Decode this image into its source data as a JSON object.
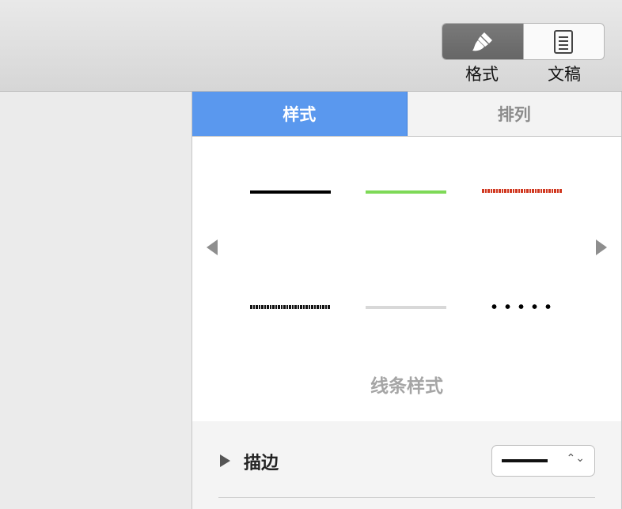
{
  "toolbar": {
    "format_label": "格式",
    "document_label": "文稿"
  },
  "inspector": {
    "tabs": [
      {
        "label": "样式",
        "active": true
      },
      {
        "label": "排列",
        "active": false
      }
    ],
    "line_styles": {
      "caption": "线条样式",
      "pages": 2,
      "current_page": 1,
      "swatches": [
        {
          "kind": "solid",
          "color": "#000000"
        },
        {
          "kind": "solid",
          "color": "#7ed957"
        },
        {
          "kind": "rough",
          "color": "#d0371f"
        },
        {
          "kind": "rough",
          "color": "#111111"
        },
        {
          "kind": "solid",
          "color": "#d8d8d8"
        },
        {
          "kind": "dotted",
          "color": "#000000"
        }
      ]
    },
    "stroke": {
      "label": "描边"
    }
  },
  "colors": {
    "tab_active": "#5a98ee",
    "toolbar_active": "#6c6c6c"
  }
}
